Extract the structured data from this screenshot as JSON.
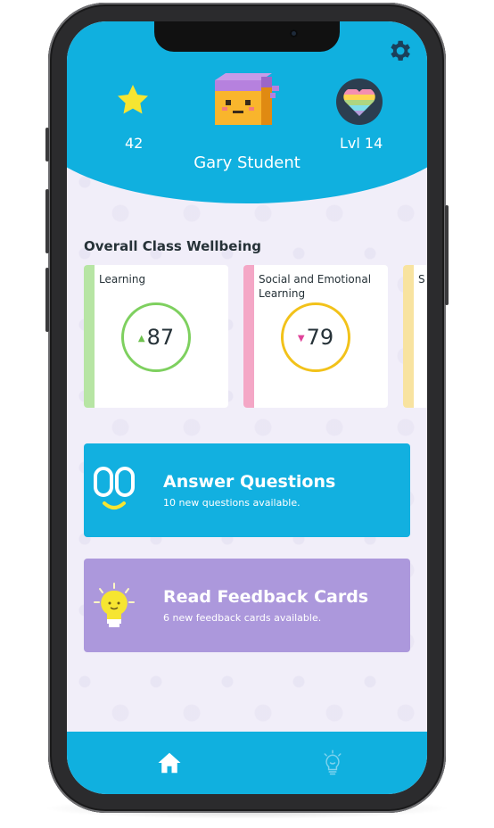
{
  "header": {
    "stars": "42",
    "user_name": "Gary Student",
    "level": "Lvl 14",
    "icons": {
      "settings": "gear-icon",
      "star": "star-icon",
      "avatar": "pixel-avatar",
      "level_badge": "rainbow-heart-icon"
    }
  },
  "wellbeing": {
    "title": "Overall Class Wellbeing",
    "cards": [
      {
        "label": "Learning",
        "score": "87",
        "trend": "up",
        "trend_glyph": "▲",
        "color": "#b7e5a4",
        "ring_color": "#7ed05f",
        "arrow_color": "#6fc24f"
      },
      {
        "label": "Social and Emotional Learning",
        "score": "79",
        "trend": "down",
        "trend_glyph": "▼",
        "color": "#f4a7c6",
        "ring_color": "#f2c21a",
        "arrow_color": "#e0439a"
      },
      {
        "label": "S",
        "score": "",
        "trend": "",
        "trend_glyph": "",
        "color": "#f8e3a0",
        "ring_color": "",
        "arrow_color": ""
      }
    ]
  },
  "actions": {
    "questions": {
      "title": "Answer Questions",
      "subtitle": "10 new questions available.",
      "icon": "question-face-icon",
      "color": "#12b0e0"
    },
    "feedback": {
      "title": "Read Feedback Cards",
      "subtitle": "6 new feedback cards available.",
      "icon": "lightbulb-icon",
      "color": "#ac98dc"
    }
  },
  "nav": {
    "tabs": [
      {
        "name": "home",
        "icon": "home-icon",
        "active": true
      },
      {
        "name": "ideas",
        "icon": "lightbulb-icon",
        "active": false
      }
    ]
  },
  "colors": {
    "primary": "#10b0df",
    "background": "#f1eef9",
    "text": "#263238"
  }
}
